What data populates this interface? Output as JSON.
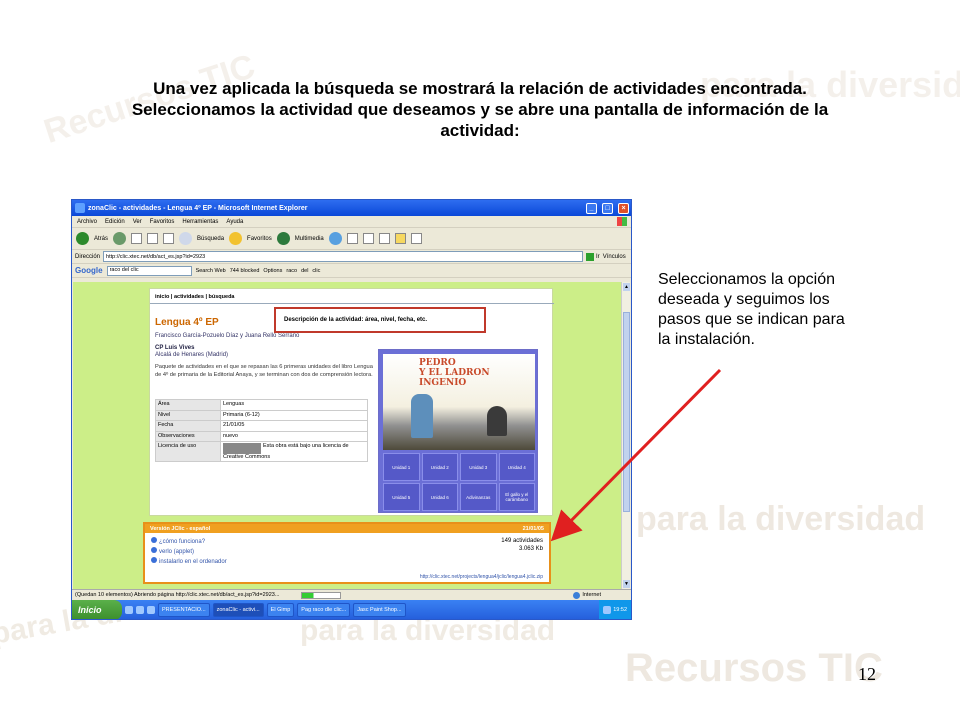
{
  "slide": {
    "title": "Una vez aplicada la búsqueda se mostrará la relación de actividades encontrada. Seleccionamos la actividad que deseamos y se abre una pantalla de información de la actividad:",
    "note": "Seleccionamos la opción deseada y seguimos los pasos que se indican para la instalación.",
    "page_number": "12",
    "watermarks": [
      "Recursos TIC",
      "para la diversidad"
    ]
  },
  "browser": {
    "title": "zonaClic - actividades - Lengua 4º EP - Microsoft Internet Explorer",
    "menu": [
      "Archivo",
      "Edición",
      "Ver",
      "Favoritos",
      "Herramientas",
      "Ayuda"
    ],
    "toolbar": {
      "back": "Atrás",
      "search": "Búsqueda",
      "favorites": "Favoritos",
      "multimedia": "Multimedia"
    },
    "address_label": "Dirección",
    "address": "http://clic.xtec.net/db/act_es.jsp?id=2923",
    "go": "Ir",
    "links": "Vínculos",
    "google": {
      "logo": "Google",
      "query": "raco del clic",
      "search_web": "Search Web",
      "blocked": "744 blocked",
      "options": "Options",
      "terms": [
        "raco",
        "del",
        "clic"
      ]
    },
    "status": {
      "text": "(Quedan 10 elementos) Abriendo página http://clic.xtec.net/db/act_es.jsp?id=2923...",
      "zone": "Internet"
    },
    "taskbar": {
      "start": "Inicio",
      "tasks": [
        "PRESENTACIO...",
        "zonaClic - activi...",
        "El Gimp",
        "Pag raco dle clic...",
        "Jasc Paint Shop..."
      ],
      "clock": "19:52"
    }
  },
  "page": {
    "breadcrumb": "inicio | actividades | búsqueda",
    "callout": "Descripción de la actividad: área, nivel, fecha, etc.",
    "title": "Lengua 4º EP",
    "authors": "Francisco García-Pozuelo Díaz y Juana Rello Serrano",
    "school": "CP Luis Vives",
    "city": "Alcalá de Henares (Madrid)",
    "description": "Paquete de actividades en el que se repasan las 6 primeras unidades del libro Lengua de 4º de primaria de la Editorial Anaya, y se terminan con dos de comprensión lectora.",
    "meta": [
      {
        "key": "Área",
        "value": "Lenguas"
      },
      {
        "key": "Nivel",
        "value": "Primaria (6-12)"
      },
      {
        "key": "Fecha",
        "value": "21/01/05"
      },
      {
        "key": "Observaciones",
        "value": "nuevo"
      },
      {
        "key": "Licencia de uso",
        "value": "Esta obra está bajo una licencia de Creative Commons"
      }
    ],
    "game": {
      "art_title": [
        "PEDRO",
        "Y EL LADRON",
        "INGENIO"
      ],
      "cells": [
        "Unidad 1",
        "Unidad 2",
        "Unidad 3",
        "Unidad 4",
        "Unidad 5",
        "Unidad 6",
        "Adivinanzas",
        "El gallo y el carámbano"
      ]
    },
    "download": {
      "header_left": "Versión JClic - español",
      "header_right": "21/01/05",
      "links": [
        "¿cómo funciona?",
        "verlo (applet)",
        "instalarlo en el ordenador"
      ],
      "activities": "149 actividades",
      "size": "3.063 Kb",
      "url": "http://clic.xtec.net/projects/lengua4/jclic/lengua4.jclic.zip"
    }
  },
  "colors": {
    "background": "#ccee88",
    "callout_border": "#c0392b",
    "download_border": "#e8901a",
    "title_color": "#cc6600",
    "arrow": "#e02020"
  }
}
